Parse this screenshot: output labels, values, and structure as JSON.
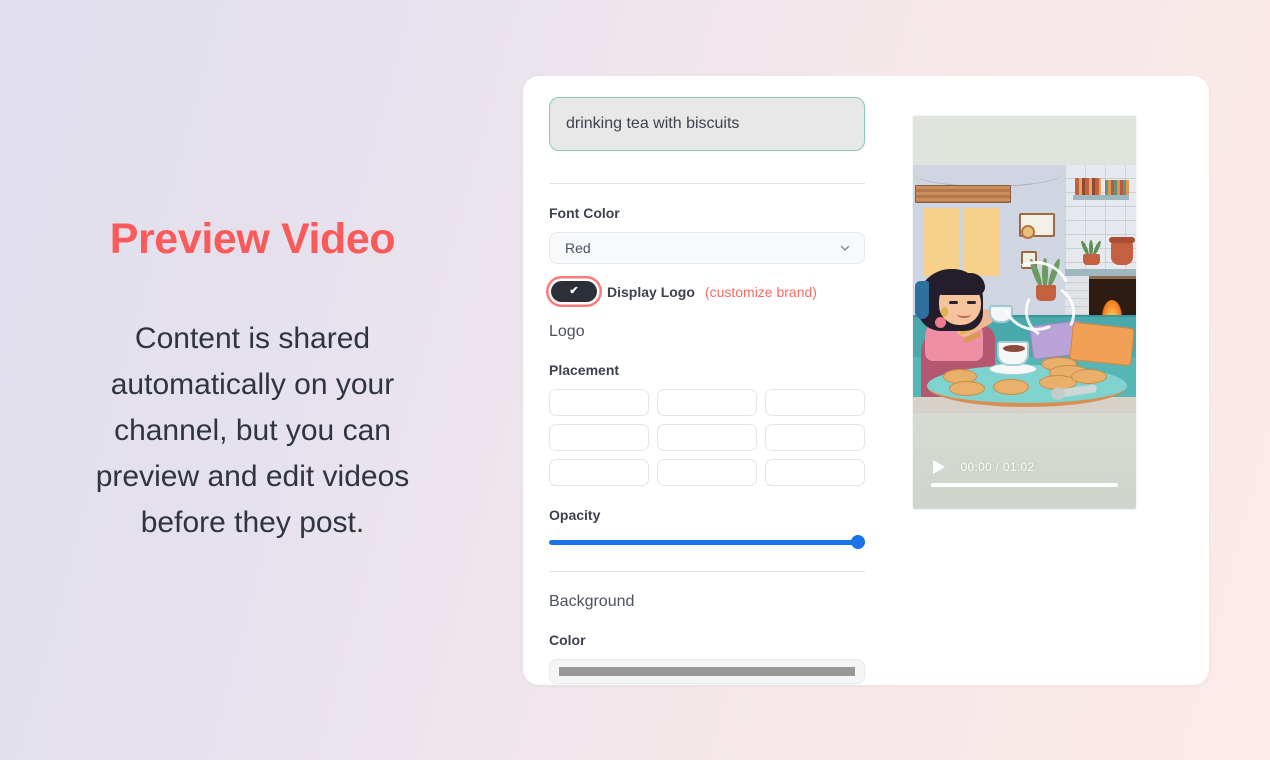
{
  "left": {
    "headline": "Preview Video",
    "body": "Content is shared automatically on your channel, but you can preview and edit videos before they post."
  },
  "form": {
    "prompt": {
      "value": "drinking tea with biscuits",
      "placeholder": "drinking tea with biscuits"
    },
    "font_color": {
      "label": "Font Color",
      "value": "Red",
      "options": [
        "Red"
      ],
      "chevron_icon": "chevron-down-icon"
    },
    "display_logo": {
      "label": "Display Logo",
      "link": "(customize brand)",
      "checked": true,
      "check_glyph": "✔"
    },
    "logo_section_title": "Logo",
    "placement": {
      "label": "Placement",
      "cells": [
        "",
        "",
        "",
        "",
        "",
        "",
        "",
        "",
        ""
      ]
    },
    "opacity": {
      "label": "Opacity",
      "value": 100
    },
    "background_section_title": "Background",
    "color": {
      "label": "Color",
      "value": "#989898"
    }
  },
  "video": {
    "play_icon": "play-icon",
    "time": "00:00 / 01:02",
    "progress": 100
  },
  "colors": {
    "accent": "#fb5a5a",
    "link": "#f96b62",
    "slider": "#1a73e8",
    "input_border": "#8ec6bd",
    "toggle_on": "#2b3038",
    "swatch": "#989898"
  }
}
